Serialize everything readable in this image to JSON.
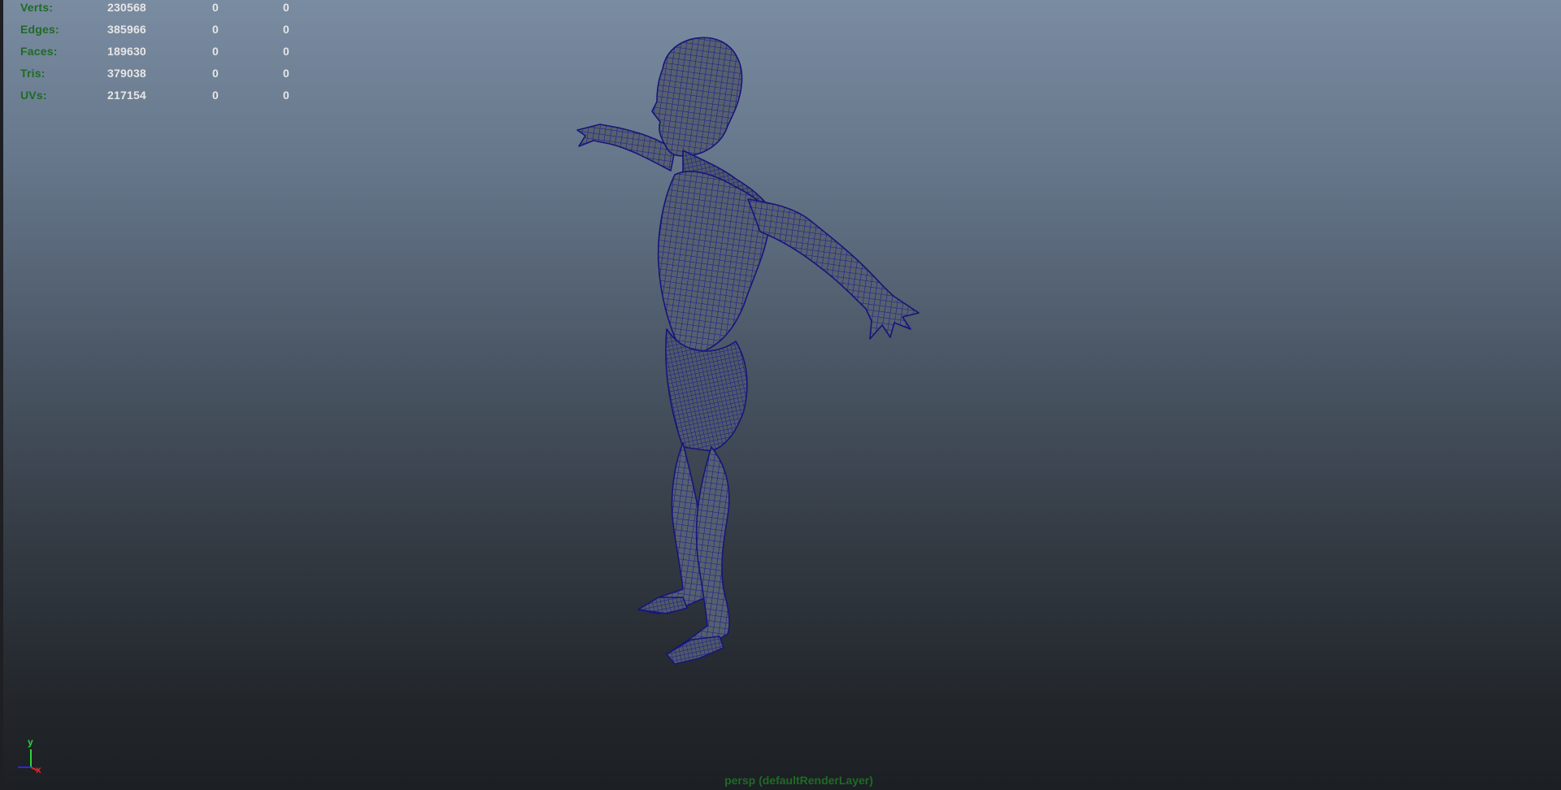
{
  "stats": {
    "rows": [
      {
        "label": "Verts:",
        "total": "230568",
        "selected": "0",
        "components": "0"
      },
      {
        "label": "Edges:",
        "total": "385966",
        "selected": "0",
        "components": "0"
      },
      {
        "label": "Faces:",
        "total": "189630",
        "selected": "0",
        "components": "0"
      },
      {
        "label": "Tris:",
        "total": "379038",
        "selected": "0",
        "components": "0"
      },
      {
        "label": "UVs:",
        "total": "217154",
        "selected": "0",
        "components": "0"
      }
    ]
  },
  "axis": {
    "y": "y",
    "x": "x"
  },
  "camera_label": "persp (defaultRenderLayer)",
  "colors": {
    "hud_label": "#1e6b26",
    "hud_value": "#e6e6e6",
    "wireframe": "#1b1a8c",
    "surface": "#4a5566"
  },
  "icons": {
    "view_axis": "xyz-axis-gizmo-icon"
  }
}
